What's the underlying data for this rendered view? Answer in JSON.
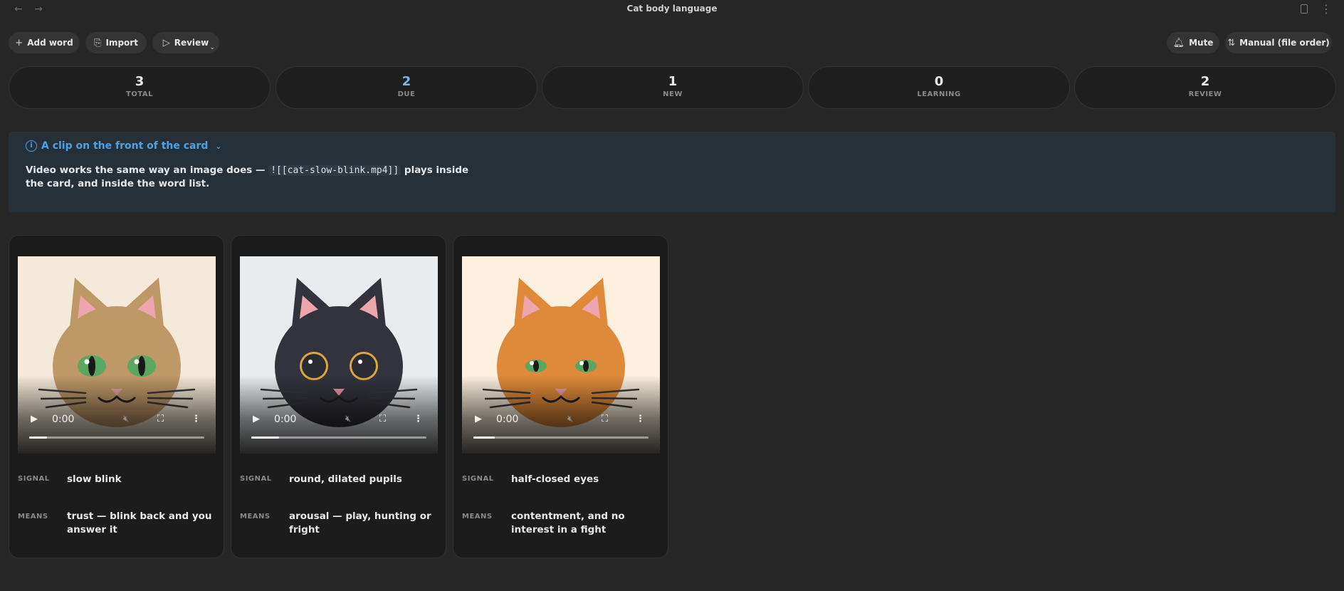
{
  "window": {
    "title": "Cat body language",
    "back_icon": "arrow-left-icon",
    "forward_icon": "arrow-right-icon",
    "file_icon": "file-icon",
    "more_icon": "more-vertical-icon"
  },
  "toolbar": {
    "add_label": "Add word",
    "import_label": "Import",
    "review_label": "Review",
    "mute_label": "Mute",
    "sort_label": "Manual (file order)"
  },
  "stats": [
    {
      "value": "3",
      "label": "TOTAL"
    },
    {
      "value": "2",
      "label": "DUE"
    },
    {
      "value": "1",
      "label": "NEW"
    },
    {
      "value": "0",
      "label": "LEARNING"
    },
    {
      "value": "2",
      "label": "REVIEW"
    }
  ],
  "callout": {
    "title": "A clip on the front of the card",
    "body_before": "Video works the same way an image does — ",
    "body_code": "![[cat-slow-blink.mp4]]",
    "body_after": " plays inside the card, and inside the word list."
  },
  "colors": {
    "accent": "#4aa3e8",
    "due": "#7fb6e6",
    "background": "#262626"
  },
  "cards": [
    {
      "time": "0:00",
      "progress": 0.1,
      "signal_label": "SIGNAL",
      "signal": "slow blink",
      "means_label": "MEANS",
      "means": "trust — blink back and you answer it",
      "cat": {
        "bg": "#f5ead9",
        "fur": "#bf9868",
        "ear_inner": "#eea6ae",
        "eye": "#5aa860",
        "eye_ring": "#4d7d52"
      }
    },
    {
      "time": "0:00",
      "progress": 0.16,
      "signal_label": "SIGNAL",
      "signal": "round, dilated pupils",
      "means_label": "MEANS",
      "means": "arousal — play, hunting or fright",
      "cat": {
        "bg": "#e8ecef",
        "fur": "#33333d",
        "ear_inner": "#eea6ae",
        "eye": "#2b2b33",
        "eye_ring": "#d9a83c"
      }
    },
    {
      "time": "0:00",
      "progress": 0.12,
      "signal_label": "SIGNAL",
      "signal": "half-closed eyes",
      "means_label": "MEANS",
      "means": "contentment, and no interest in a fight",
      "cat": {
        "bg": "#fdf0de",
        "fur": "#df8a3a",
        "ear_inner": "#eea6ae",
        "eye": "#5aa860",
        "eye_ring": "#4d7d52"
      }
    }
  ]
}
